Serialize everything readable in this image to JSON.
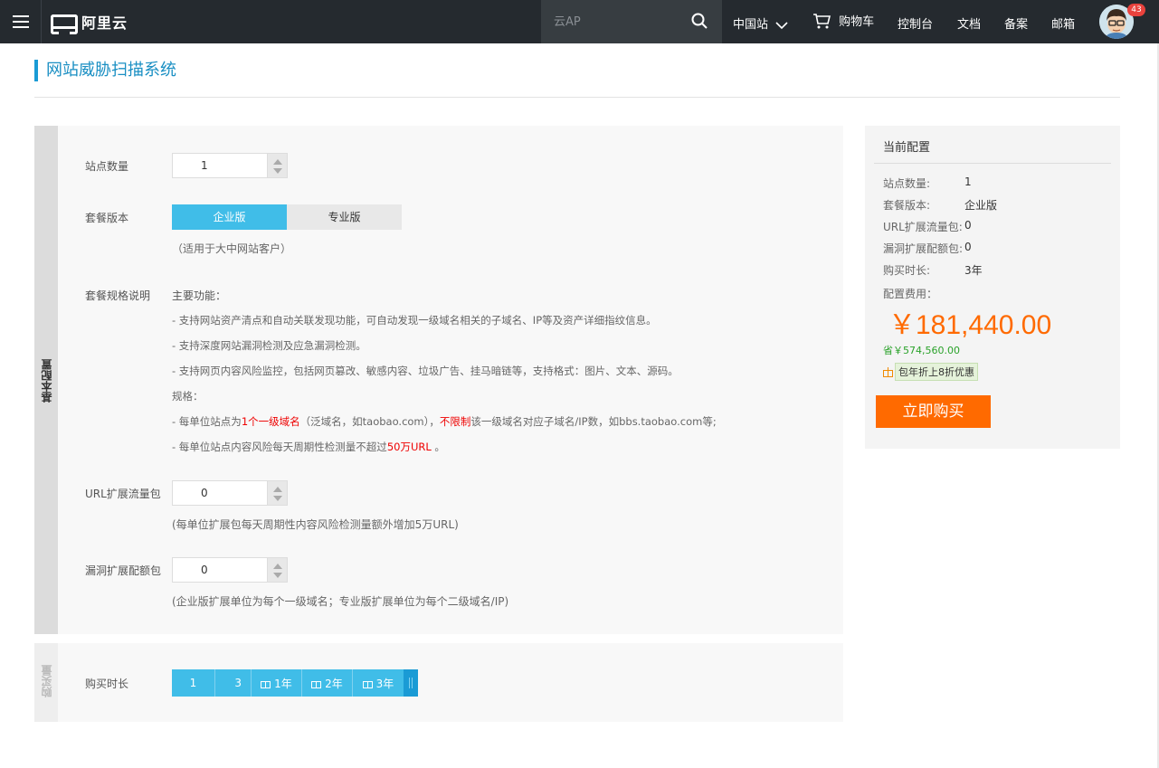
{
  "topbar": {
    "brand": "阿里云",
    "search_placeholder": "云AP",
    "region": "中国站",
    "cart": "购物车",
    "console": "控制台",
    "docs": "文档",
    "beian": "备案",
    "mail": "邮箱",
    "badge_count": "43"
  },
  "page": {
    "title": "网站威胁扫描系统"
  },
  "config": {
    "section_label": "基本配置",
    "site_count_label": "站点数量",
    "site_count_value": "1",
    "edition_label": "套餐版本",
    "editions": [
      "企业版",
      "专业版"
    ],
    "edition_hint": "（适用于大中网站客户）",
    "spec_label": "套餐规格说明",
    "spec_heading": "主要功能：",
    "features": [
      "- 支持网站资产清点和自动关联发现功能，可自动发现一级域名相关的子域名、IP等及资产详细指纹信息。",
      "- 支持深度网站漏洞检测及应急漏洞检测。",
      "- 支持网页内容风险监控，包括网页篡改、敏感内容、垃圾广告、挂马暗链等，支持格式：图片、文本、源码。"
    ],
    "spec_sub": "规格：",
    "spec1_a": "- 每单位站点为",
    "spec1_b": "1个一级域名",
    "spec1_c": "（泛域名，如taobao.com），",
    "spec1_d": "不限制",
    "spec1_e": "该一级域名对应子域名/IP数，如bbs.taobao.com等;",
    "spec2_a": "- 每单位站点内容风险每天周期性检测量不超过",
    "spec2_b": "50万URL",
    "spec2_c": " 。",
    "url_pack_label": "URL扩展流量包",
    "url_pack_value": "0",
    "url_pack_hint": "(每单位扩展包每天周期性内容风险检测量额外增加5万URL)",
    "vuln_pack_label": "漏洞扩展配额包",
    "vuln_pack_value": "0",
    "vuln_pack_hint": "(企业版扩展单位为每个一级域名；专业版扩展单位为每个二级域名/IP)"
  },
  "purchase": {
    "section_label": "购买量",
    "duration_label": "购买时长",
    "options": [
      "1",
      "3",
      "1年",
      "2年",
      "3年"
    ]
  },
  "summary": {
    "title": "当前配置",
    "rows": [
      {
        "label": "站点数量:",
        "value": "1"
      },
      {
        "label": "套餐版本:",
        "value": "企业版"
      },
      {
        "label": "URL扩展流量包:",
        "value": "0"
      },
      {
        "label": "漏洞扩展配额包:",
        "value": "0"
      },
      {
        "label": "购买时长:",
        "value": "3年"
      }
    ],
    "fee_label": "配置费用：",
    "price": "￥181,440.00",
    "saving": "省￥574,560.00",
    "promo": "包年折上8折优惠",
    "buy_label": "立即购买"
  },
  "colors": {
    "accent": "#40bde8",
    "price": "#ff6a00",
    "topbar": "#252a2f"
  }
}
